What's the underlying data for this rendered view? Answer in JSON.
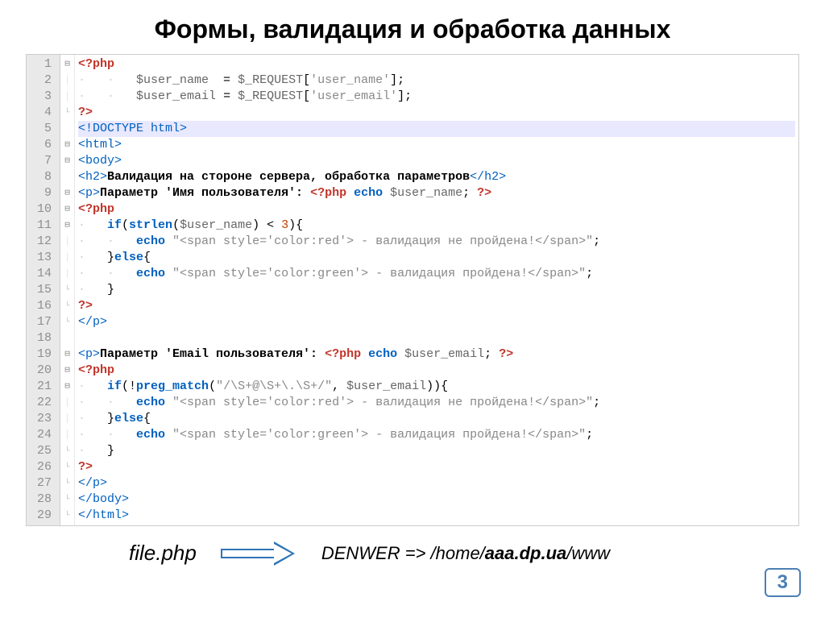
{
  "title": "Формы, валидация и обработка данных",
  "filename": "file.php",
  "path_prefix": "DENWER => /home/",
  "path_bold": "aaa.dp.ua",
  "path_suffix": "/www",
  "page_number": "3",
  "code_lines": [
    {
      "n": 1,
      "fold": "minus",
      "html": "<span class='php-tag'>&lt;?php</span>"
    },
    {
      "n": 2,
      "fold": "pipe",
      "html": "<span class='guide'>·   ·   </span><span class='var'>$user_name</span>  <span class='op'>=</span> <span class='var'>$_REQUEST</span><span class='op'>[</span><span class='str'>'user_name'</span><span class='op'>];</span>"
    },
    {
      "n": 3,
      "fold": "pipe",
      "html": "<span class='guide'>·   ·   </span><span class='var'>$user_email</span> <span class='op'>=</span> <span class='var'>$_REQUEST</span><span class='op'>[</span><span class='str'>'user_email'</span><span class='op'>];</span>"
    },
    {
      "n": 4,
      "fold": "end",
      "html": "<span class='php-tag'>?&gt;</span>"
    },
    {
      "n": 5,
      "fold": "",
      "hl": true,
      "html": "<span class='tag'>&lt;!DOCTYPE html&gt;</span>"
    },
    {
      "n": 6,
      "fold": "minus",
      "html": "<span class='tag'>&lt;html&gt;</span>"
    },
    {
      "n": 7,
      "fold": "minus",
      "html": "<span class='tag'>&lt;body&gt;</span>"
    },
    {
      "n": 8,
      "fold": "",
      "html": "<span class='tag'>&lt;h2&gt;</span><span class='txt'>Валидация на стороне сервера, обработка параметров</span><span class='tag'>&lt;/h2&gt;</span>"
    },
    {
      "n": 9,
      "fold": "minus",
      "html": "<span class='tag'>&lt;p&gt;</span><span class='txt'>Параметр 'Имя пользователя': </span><span class='php-tag'>&lt;?php</span> <span class='kw'>echo</span> <span class='var'>$user_name</span><span class='op'>;</span> <span class='php-tag'>?&gt;</span>"
    },
    {
      "n": 10,
      "fold": "minus",
      "html": "<span class='php-tag'>&lt;?php</span>"
    },
    {
      "n": 11,
      "fold": "minus",
      "html": "<span class='guide'>·   </span><span class='kw'>if</span><span class='op'>(</span><span class='func'>strlen</span><span class='op'>(</span><span class='var'>$user_name</span><span class='op'>) &lt; </span><span class='num'>3</span><span class='op'>){</span>"
    },
    {
      "n": 12,
      "fold": "pipe",
      "html": "<span class='guide'>·   ·   </span><span class='kw'>echo</span> <span class='str'>\"&lt;span style='color:red'&gt; - валидация не пройдена!&lt;/span&gt;\"</span><span class='op'>;</span>"
    },
    {
      "n": 13,
      "fold": "pipe",
      "html": "<span class='guide'>·   </span><span class='op'>}</span><span class='kw'>else</span><span class='op'>{</span>"
    },
    {
      "n": 14,
      "fold": "pipe",
      "html": "<span class='guide'>·   ·   </span><span class='kw'>echo</span> <span class='str'>\"&lt;span style='color:green'&gt; - валидация пройдена!&lt;/span&gt;\"</span><span class='op'>;</span>"
    },
    {
      "n": 15,
      "fold": "end",
      "html": "<span class='guide'>·   </span><span class='op'>}</span>"
    },
    {
      "n": 16,
      "fold": "end",
      "html": "<span class='php-tag'>?&gt;</span>"
    },
    {
      "n": 17,
      "fold": "end",
      "html": "<span class='tag'>&lt;/p&gt;</span>"
    },
    {
      "n": 18,
      "fold": "",
      "html": ""
    },
    {
      "n": 19,
      "fold": "minus",
      "html": "<span class='tag'>&lt;p&gt;</span><span class='txt'>Параметр 'Email пользователя': </span><span class='php-tag'>&lt;?php</span> <span class='kw'>echo</span> <span class='var'>$user_email</span><span class='op'>;</span> <span class='php-tag'>?&gt;</span>"
    },
    {
      "n": 20,
      "fold": "minus",
      "html": "<span class='php-tag'>&lt;?php</span>"
    },
    {
      "n": 21,
      "fold": "minus",
      "html": "<span class='guide'>·   </span><span class='kw'>if</span><span class='op'>(!</span><span class='func'>preg_match</span><span class='op'>(</span><span class='str'>\"/\\S+@\\S+\\.\\S+/\"</span><span class='op'>, </span><span class='var'>$user_email</span><span class='op'>)){</span>"
    },
    {
      "n": 22,
      "fold": "pipe",
      "html": "<span class='guide'>·   ·   </span><span class='kw'>echo</span> <span class='str'>\"&lt;span style='color:red'&gt; - валидация не пройдена!&lt;/span&gt;\"</span><span class='op'>;</span>"
    },
    {
      "n": 23,
      "fold": "pipe",
      "html": "<span class='guide'>·   </span><span class='op'>}</span><span class='kw'>else</span><span class='op'>{</span>"
    },
    {
      "n": 24,
      "fold": "pipe",
      "html": "<span class='guide'>·   ·   </span><span class='kw'>echo</span> <span class='str'>\"&lt;span style='color:green'&gt; - валидация пройдена!&lt;/span&gt;\"</span><span class='op'>;</span>"
    },
    {
      "n": 25,
      "fold": "end",
      "html": "<span class='guide'>·   </span><span class='op'>}</span>"
    },
    {
      "n": 26,
      "fold": "end",
      "html": "<span class='php-tag'>?&gt;</span>"
    },
    {
      "n": 27,
      "fold": "end",
      "html": "<span class='tag'>&lt;/p&gt;</span>"
    },
    {
      "n": 28,
      "fold": "end",
      "html": "<span class='tag'>&lt;/body&gt;</span>"
    },
    {
      "n": 29,
      "fold": "end",
      "html": "<span class='tag'>&lt;/html&gt;</span>"
    }
  ]
}
